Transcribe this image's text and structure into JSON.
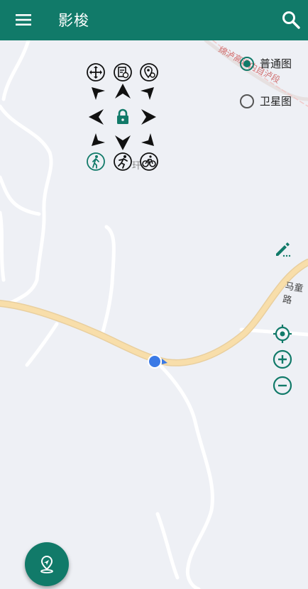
{
  "appbar": {
    "title": "影梭"
  },
  "map_type": {
    "options": [
      {
        "label": "普通图",
        "selected": true
      },
      {
        "label": "卫星图",
        "selected": false
      }
    ]
  },
  "map_labels": {
    "road_top": "绵泸高速内自泸段",
    "road_right": "马童路",
    "poi": "玕"
  },
  "colors": {
    "primary": "#117a69",
    "road": "#f8deaa",
    "location": "#3b7ae6"
  }
}
